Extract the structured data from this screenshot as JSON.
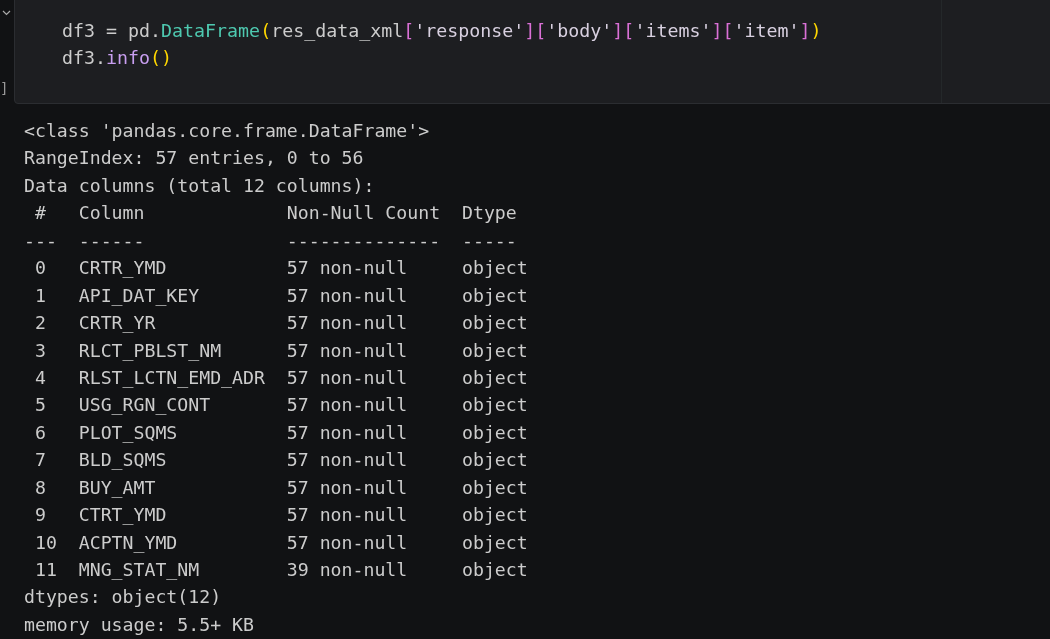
{
  "cell": {
    "execution_count": "]",
    "code_lines": [
      [
        {
          "kind": "plain",
          "text": "df3 = pd."
        },
        {
          "kind": "class",
          "text": "DataFrame"
        },
        {
          "kind": "paren",
          "text": "("
        },
        {
          "kind": "plain",
          "text": "res_data_xml"
        },
        {
          "kind": "bracket",
          "text": "["
        },
        {
          "kind": "string",
          "text": "'response'"
        },
        {
          "kind": "bracket",
          "text": "]["
        },
        {
          "kind": "string",
          "text": "'body'"
        },
        {
          "kind": "bracket",
          "text": "]["
        },
        {
          "kind": "string",
          "text": "'items'"
        },
        {
          "kind": "bracket",
          "text": "]["
        },
        {
          "kind": "string",
          "text": "'item'"
        },
        {
          "kind": "bracket",
          "text": "]"
        },
        {
          "kind": "paren",
          "text": ")"
        }
      ],
      [
        {
          "kind": "plain",
          "text": "df3."
        },
        {
          "kind": "method",
          "text": "info"
        },
        {
          "kind": "paren",
          "text": "()"
        }
      ]
    ]
  },
  "output": {
    "lines": [
      "<class 'pandas.core.frame.DataFrame'>",
      "RangeIndex: 57 entries, 0 to 56",
      "Data columns (total 12 columns):",
      " #   Column             Non-Null Count  Dtype ",
      "---  ------             --------------  ----- ",
      " 0   CRTR_YMD           57 non-null     object",
      " 1   API_DAT_KEY        57 non-null     object",
      " 2   CRTR_YR            57 non-null     object",
      " 3   RLCT_PBLST_NM      57 non-null     object",
      " 4   RLST_LCTN_EMD_ADR  57 non-null     object",
      " 5   USG_RGN_CONT       57 non-null     object",
      " 6   PLOT_SQMS          57 non-null     object",
      " 7   BLD_SQMS           57 non-null     object",
      " 8   BUY_AMT            57 non-null     object",
      " 9   CTRT_YMD           57 non-null     object",
      " 10  ACPTN_YMD          57 non-null     object",
      " 11  MNG_STAT_NM        39 non-null     object",
      "dtypes: object(12)",
      "memory usage: 5.5+ KB"
    ]
  }
}
